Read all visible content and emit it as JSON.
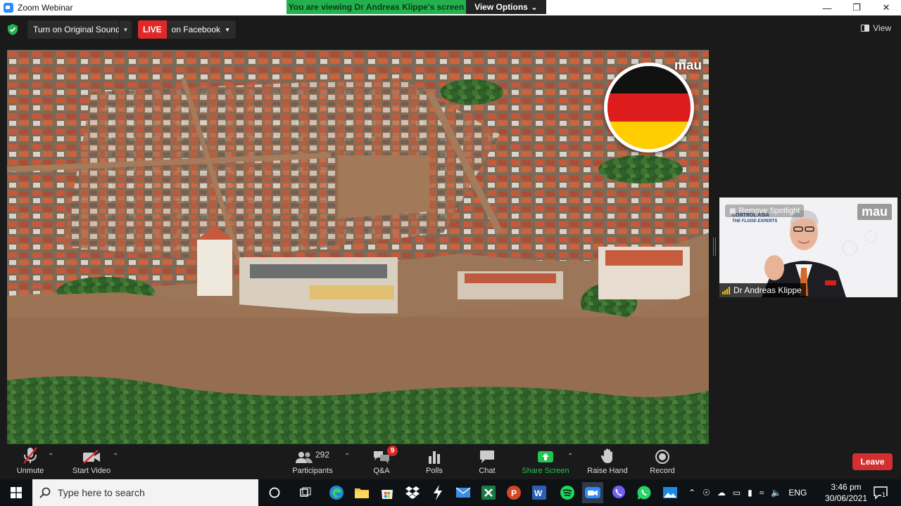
{
  "window": {
    "title": "Zoom Webinar",
    "viewing_banner": "You are viewing Dr Andreas Klippe's screen",
    "view_options": "View Options"
  },
  "topbar": {
    "original_sound": "Turn on Original Sound",
    "live_badge": "LIVE",
    "live_destination": "on Facebook",
    "view_label": "View"
  },
  "shared_screen": {
    "watermark": "mau"
  },
  "speaker": {
    "remove_spotlight": "Remove Spotlight",
    "logo_text": "CONTROL ASIA",
    "logo_tagline": "THE FLOOD EXPERTS",
    "brand": "mau",
    "name": "Dr Andreas Klippe"
  },
  "toolbar": {
    "unmute": "Unmute",
    "start_video": "Start Video",
    "participants": "Participants",
    "participants_count": "292",
    "qa": "Q&A",
    "qa_badge": "9",
    "polls": "Polls",
    "chat": "Chat",
    "share_screen": "Share Screen",
    "raise_hand": "Raise Hand",
    "record": "Record",
    "leave": "Leave"
  },
  "taskbar": {
    "search_placeholder": "Type here to search",
    "language": "ENG",
    "time": "3:46 pm",
    "date": "30/06/2021",
    "notification_count": "1"
  },
  "colors": {
    "zoom_green": "#23b14d",
    "live_red": "#e02828",
    "leave_red": "#d32f2f",
    "zoom_blue": "#2d8cff"
  }
}
